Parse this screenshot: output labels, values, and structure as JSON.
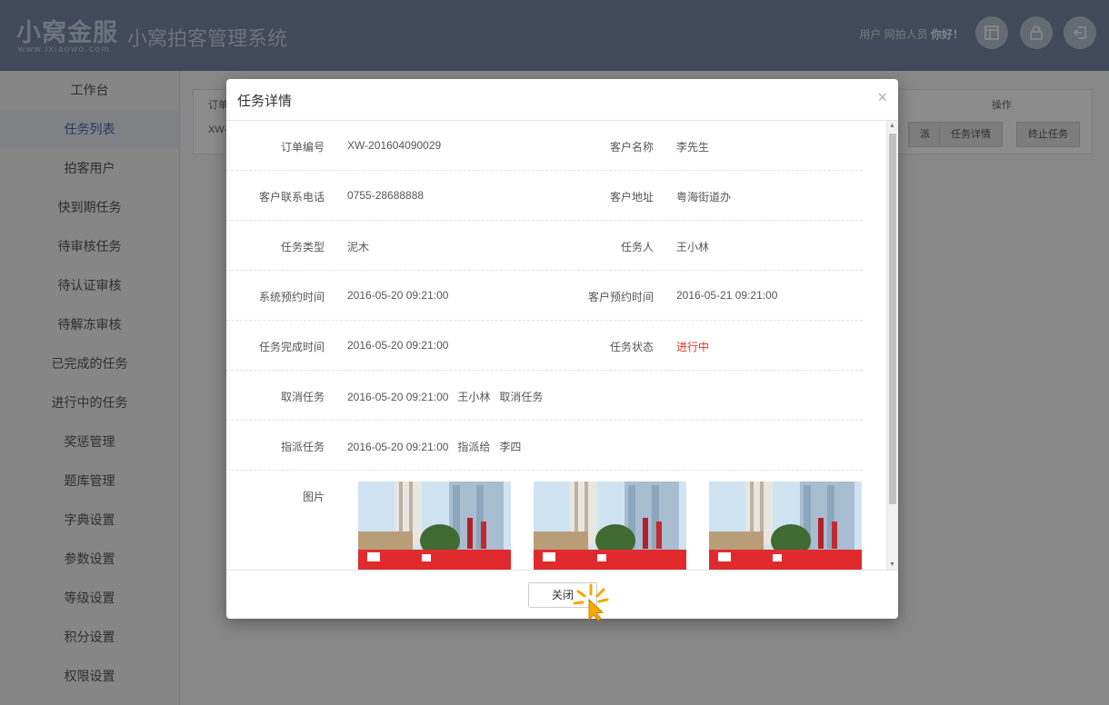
{
  "header": {
    "logo_cn": "小窝金服",
    "logo_url": "www.ixiaowo.com",
    "system_title": "小窝拍客管理系统",
    "greeting_prefix": "用户",
    "greeting_name": "网拍人员",
    "greeting_suffix": "你好！",
    "icons": [
      "layout-icon",
      "lock-icon",
      "logout-icon"
    ]
  },
  "sidebar": {
    "items": [
      {
        "label": "工作台"
      },
      {
        "label": "任务列表"
      },
      {
        "label": "拍客用户"
      },
      {
        "label": "快到期任务"
      },
      {
        "label": "待审核任务"
      },
      {
        "label": "待认证审核"
      },
      {
        "label": "待解冻审核"
      },
      {
        "label": "已完成的任务"
      },
      {
        "label": "进行中的任务"
      },
      {
        "label": "奖惩管理"
      },
      {
        "label": "题库管理"
      },
      {
        "label": "字典设置"
      },
      {
        "label": "参数设置"
      },
      {
        "label": "等级设置"
      },
      {
        "label": "积分设置"
      },
      {
        "label": "权限设置"
      }
    ],
    "active_index": 1
  },
  "table": {
    "col_order": "订单",
    "col_ops": "操作",
    "row_id": "XW-",
    "btn_partial": "派",
    "btn_detail": "任务详情",
    "btn_stop": "终止任务"
  },
  "modal": {
    "title": "任务详情",
    "close_x": "×",
    "rows": {
      "order_no": {
        "label": "订单编号",
        "value": "XW-201604090029"
      },
      "customer_name": {
        "label": "客户名称",
        "value": "李先生"
      },
      "customer_phone": {
        "label": "客户联系电话",
        "value": "0755-28688888"
      },
      "customer_address": {
        "label": "客户地址",
        "value": "粤海街道办"
      },
      "task_type": {
        "label": "任务类型",
        "value": "泥木"
      },
      "assignee": {
        "label": "任务人",
        "value": "王小林"
      },
      "system_booking_time": {
        "label": "系统预约时间",
        "value": "2016-05-20 09:21:00"
      },
      "customer_booking_time": {
        "label": "客户预约时间",
        "value": "2016-05-21 09:21:00"
      },
      "completion_time": {
        "label": "任务完成时间",
        "value": "2016-05-20 09:21:00"
      },
      "task_status": {
        "label": "任务状态",
        "value": "进行中"
      },
      "cancel_task": {
        "label": "取消任务",
        "value": "2016-05-20 09:21:00   王小林   取消任务"
      },
      "dispatch_task": {
        "label": "指派任务",
        "value": "2016-05-20 09:21:00   指派给   李四"
      },
      "images": {
        "label": "图片"
      }
    },
    "close_button": "关闭",
    "status_color": "#e2332e"
  }
}
